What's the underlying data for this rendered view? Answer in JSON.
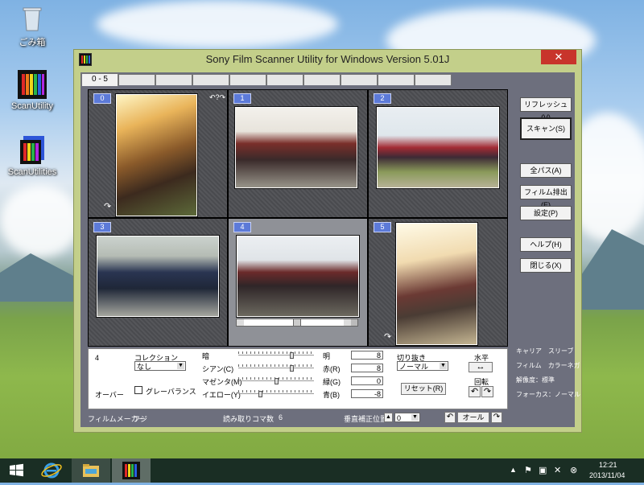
{
  "desktop": {
    "icons": [
      {
        "label": "ごみ箱",
        "icon": "recycle-bin-icon"
      },
      {
        "label": "ScanUtility",
        "icon": "film-strip-icon"
      },
      {
        "label": "ScanUtilities",
        "icon": "film-strip-stack-icon"
      }
    ]
  },
  "window": {
    "title": "Sony Film Scanner Utility for Windows Version 5.01J",
    "close_symbol": "✕",
    "tabs": [
      "0 - 5",
      "",
      "",
      "",
      "",
      "",
      "",
      "",
      "",
      ""
    ],
    "thumbnails": [
      {
        "number": "0",
        "mark": "↷"
      },
      {
        "number": "1",
        "mark": "↶?↷"
      },
      {
        "number": "2",
        "mark": ""
      },
      {
        "number": "3",
        "mark": ""
      },
      {
        "number": "4",
        "mark": ""
      },
      {
        "number": "5",
        "mark": "↷"
      }
    ],
    "controls": {
      "frame_number": "4",
      "over_label": "オーバー",
      "correction_label": "コレクション",
      "correction_value": "なし",
      "gray_balance_label": "グレーバランス",
      "sliders": [
        {
          "left": "暗",
          "right": "明",
          "value": "8",
          "level": 0.72
        },
        {
          "left": "シアン(C)",
          "right": "赤(R)",
          "value": "8",
          "level": 0.72
        },
        {
          "left": "マゼンタ(M)",
          "right": "緑(G)",
          "value": "0",
          "level": 0.5
        },
        {
          "left": "イエロー(Y)",
          "right": "青(B)",
          "value": "-8",
          "level": 0.28
        }
      ],
      "crop_label": "切り抜き",
      "crop_value": "ノーマル",
      "reset_label": "リセット(R)",
      "horizontal_label": "水平",
      "horizontal_symbol": "↔",
      "rotate_label": "回転",
      "rotate_left": "↶",
      "rotate_right": "↷"
    },
    "bottom": {
      "maker_label": "フィルムメーカー",
      "maker_value": "フジ",
      "frames_label": "読み取りコマ数",
      "frames_value": "6",
      "vcorr_label": "垂直補正位置",
      "vcorr_value": "0",
      "all_label": "オール"
    },
    "right_buttons": [
      {
        "label": "リフレッシュ(V)"
      },
      {
        "label": "スキャン(S)"
      },
      {
        "label": "全パス(A)"
      },
      {
        "label": "フィルム排出(E)"
      },
      {
        "label": "設定(P)"
      },
      {
        "label": "ヘルプ(H)"
      },
      {
        "label": "閉じる(X)"
      }
    ],
    "info": [
      {
        "label": "キャリア",
        "value": "スリーブ"
      },
      {
        "label": "フィルム",
        "value": "カラーネガ"
      },
      {
        "label": "解像度",
        "value": "標準"
      },
      {
        "label": "フォーカス",
        "value": "ノーマル"
      }
    ]
  },
  "taskbar": {
    "time": "12:21",
    "date": "2013/11/04"
  }
}
